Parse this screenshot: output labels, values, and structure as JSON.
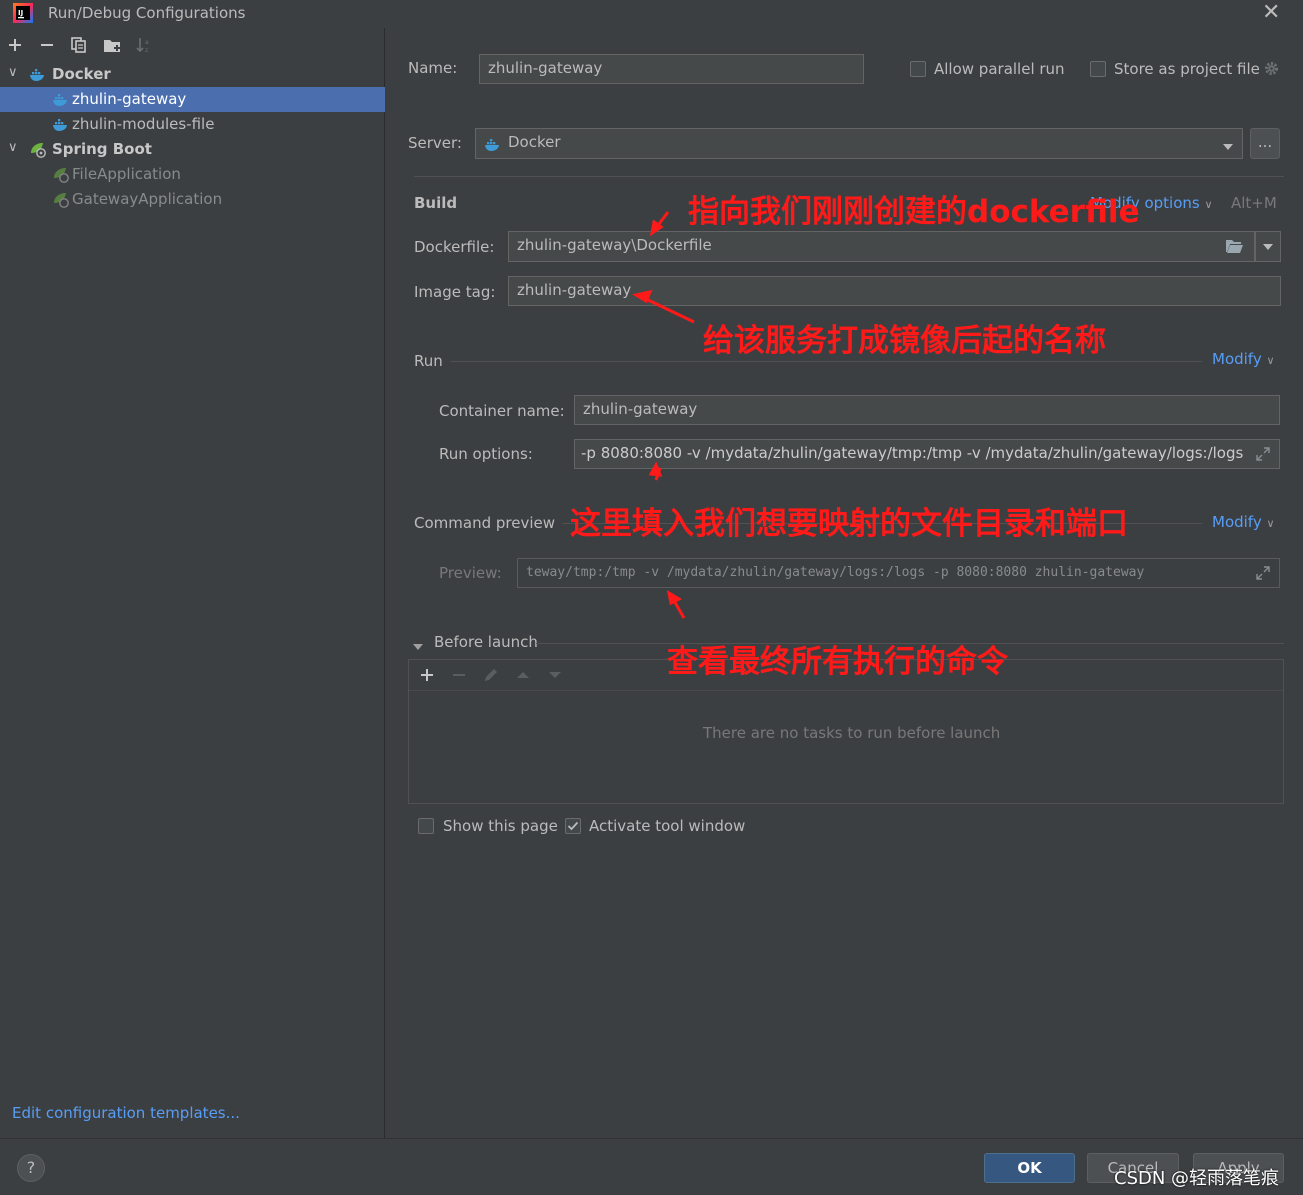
{
  "window": {
    "title": "Run/Debug Configurations"
  },
  "sidebar": {
    "toolbar": [
      "add-icon",
      "remove-icon",
      "copy-icon",
      "folder-add-icon",
      "sort-icon"
    ],
    "tree": [
      {
        "label": "Docker",
        "level": 0,
        "icon": "docker-icon",
        "expanded": true
      },
      {
        "label": "zhulin-gateway",
        "level": 1,
        "icon": "docker-icon",
        "selected": true
      },
      {
        "label": "zhulin-modules-file",
        "level": 1,
        "icon": "docker-icon"
      },
      {
        "label": "Spring Boot",
        "level": 0,
        "icon": "spring-boot-icon",
        "expanded": true
      },
      {
        "label": "FileApplication",
        "level": 1,
        "icon": "spring-boot-icon",
        "disabled": true
      },
      {
        "label": "GatewayApplication",
        "level": 1,
        "icon": "spring-boot-icon",
        "disabled": true
      }
    ],
    "edit_templates": "Edit configuration templates..."
  },
  "form": {
    "name_label": "Name:",
    "name_value": "zhulin-gateway",
    "allow_parallel": "Allow parallel run",
    "store_project": "Store as project file",
    "server_label": "Server:",
    "server_value": "Docker",
    "server_more": "...",
    "build_title": "Build",
    "modify_options": "Modify options",
    "modify_shortcut": "Alt+M",
    "dockerfile_label": "Dockerfile:",
    "dockerfile_value": "zhulin-gateway\\Dockerfile",
    "image_tag_label": "Image tag:",
    "image_tag_value": "zhulin-gateway",
    "run_title": "Run",
    "modify": "Modify",
    "container_label": "Container name:",
    "container_value": "zhulin-gateway",
    "run_options_label": "Run options:",
    "run_options_value": "-p 8080:8080 -v /mydata/zhulin/gateway/tmp:/tmp -v /mydata/zhulin/gateway/logs:/logs",
    "command_preview_title": "Command preview",
    "modify2": "Modify",
    "preview_label": "Preview:",
    "preview_value": "teway/tmp:/tmp -v /mydata/zhulin/gateway/logs:/logs -p 8080:8080 zhulin-gateway",
    "before_launch_title": "Before launch",
    "no_tasks": "There are no tasks to run before launch",
    "show_page": "Show this page",
    "activate_tool": "Activate tool window"
  },
  "buttons": {
    "ok": "OK",
    "cancel": "Cancel",
    "apply": "Apply",
    "help": "?"
  },
  "annotations": {
    "dockerfile_note": "指向我们刚刚创建的dockerfile",
    "image_tag_note": "给该服务打成镜像后起的名称",
    "run_options_note": "这里填入我们想要映射的文件目录和端口",
    "preview_note": "查看最终所有执行的命令"
  },
  "watermark": "CSDN @轻雨落笔痕",
  "colors": {
    "background": "#3c3f41",
    "selection": "#4b6eaf",
    "link": "#589df6",
    "annotation": "#ff1a1a",
    "ok_button": "#365880"
  }
}
